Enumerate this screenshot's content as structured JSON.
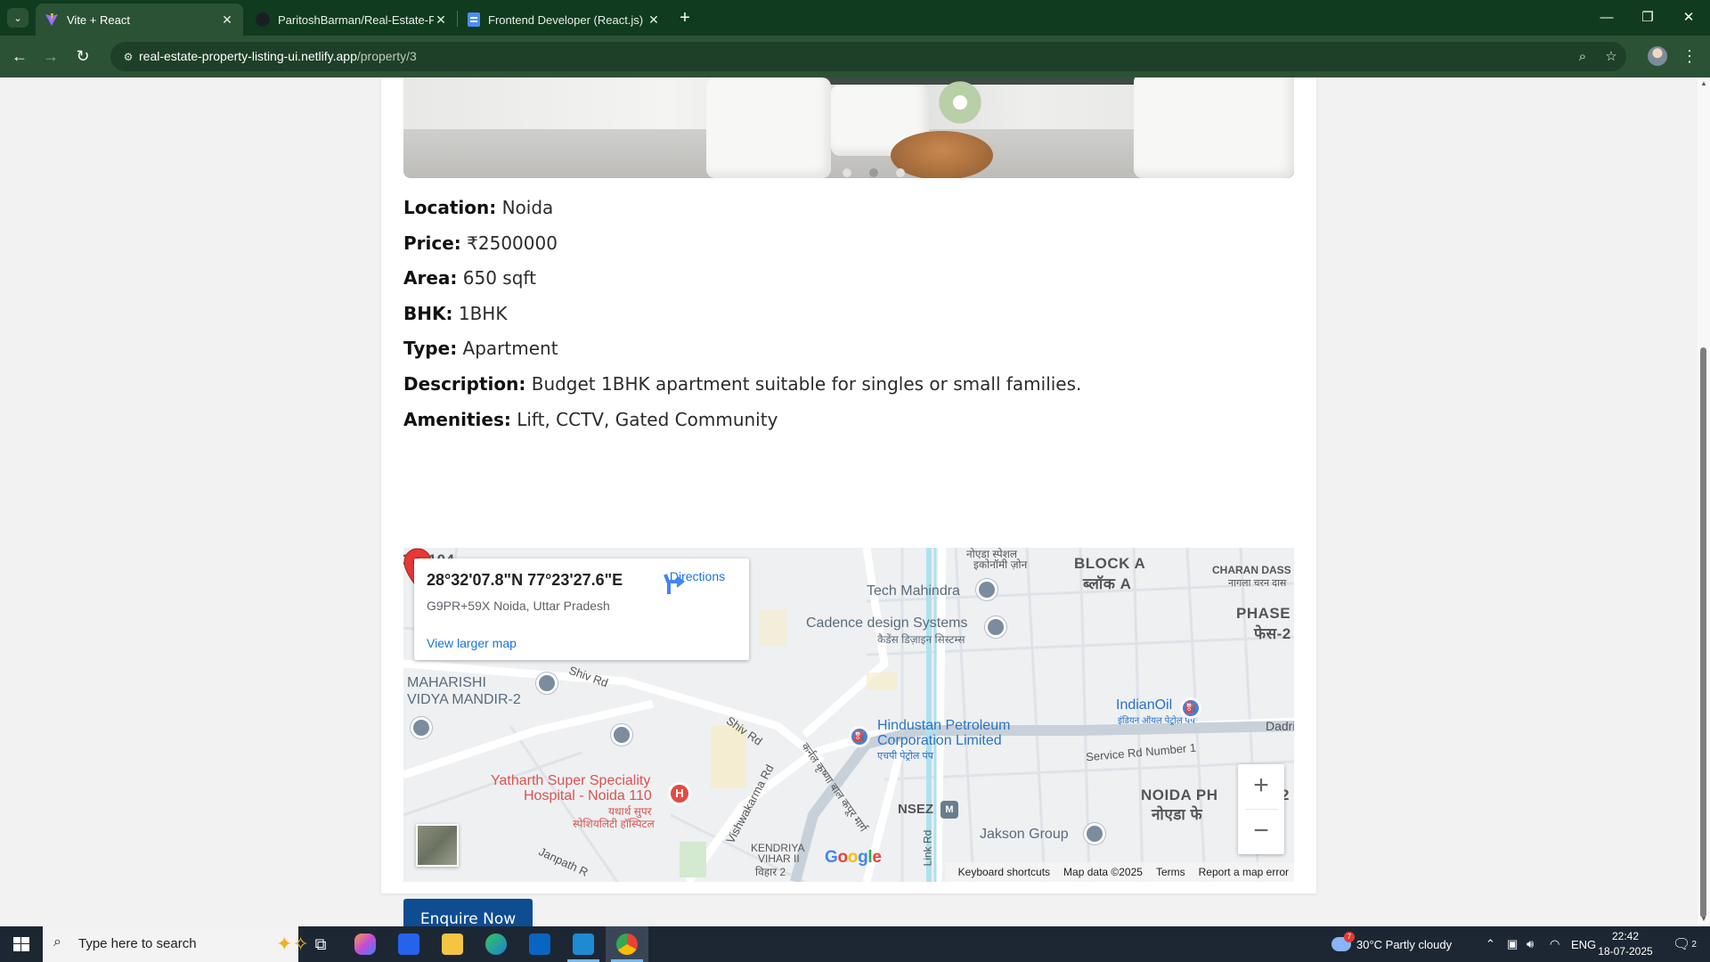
{
  "browser": {
    "tabs": [
      {
        "title": "Vite + React",
        "favicon": "vite-icon",
        "active": true
      },
      {
        "title": "ParitoshBarman/Real-Estate-Pro",
        "favicon": "github-icon",
        "active": false
      },
      {
        "title": "Frontend Developer (React.js) In",
        "favicon": "docs-icon",
        "active": false
      }
    ],
    "url_host": "real-estate-property-listing-ui.netlify.app",
    "url_path": "/property/3"
  },
  "property": {
    "details": [
      {
        "label": "Location:",
        "value": "Noida"
      },
      {
        "label": "Price:",
        "value": "₹2500000"
      },
      {
        "label": "Area:",
        "value": "650 sqft"
      },
      {
        "label": "BHK:",
        "value": "1BHK"
      },
      {
        "label": "Type:",
        "value": "Apartment"
      },
      {
        "label": "Description:",
        "value": "Budget 1BHK apartment suitable for singles or small families."
      },
      {
        "label": "Amenities:",
        "value": "Lift, CCTV, Gated Community"
      }
    ],
    "carousel": {
      "slide_count": 3,
      "active_index": 1
    },
    "enquire_label": "Enquire Now"
  },
  "map": {
    "coordinates": "28°32'07.8\"N 77°23'27.6\"E",
    "plus_code": "G9PR+59X Noida, Uttar Pradesh",
    "directions_label": "Directions",
    "larger_map_label": "View larger map",
    "google_letters": [
      "G",
      "o",
      "o",
      "g",
      "l",
      "e"
    ],
    "google_colors": [
      "#4285F4",
      "#EA4335",
      "#FBBC05",
      "#4285F4",
      "#34A853",
      "#EA4335"
    ],
    "attribution": {
      "shortcuts": "Keyboard shortcuts",
      "data": "Map data ©2025",
      "terms": "Terms",
      "report": "Report a map error"
    },
    "labels": {
      "block_a": "BLOCK A",
      "block_a_hi": "ब्लॉक A",
      "tech_mahindra": "Tech Mahindra",
      "cadence": "Cadence design Systems",
      "cadence_hi": "कैडेंस डिज़ाइन सिस्टम्स",
      "charan": "CHARAN DASS",
      "charan_hi": "नागला चरन दास",
      "phase": "PHASE",
      "phase_hi": "फेस-2",
      "maharishi": "MAHARISHI",
      "vidya": "VIDYA MANDIR-2",
      "shiv_rd_1": "Shiv Rd",
      "shiv_rd_2": "Shiv Rd",
      "hpcl_1": "Hindustan Petroleum",
      "hpcl_2": "Corporation Limited",
      "hpcl_hi": "एचपी पेट्रोल पंप",
      "indianoil": "IndianOil",
      "indianoil_hi": "इंडियन ऑयल पेट्रोल पंप",
      "dadri": "Dadri",
      "service_rd": "Service Rd Number 1",
      "yatharth_1": "Yatharth Super Speciality",
      "yatharth_2": "Hospital - Noida 110",
      "yatharth_hi_1": "यथार्थ सुपर",
      "yatharth_hi_2": "स्पेशियलिटी हॉस्पिटल",
      "vishwakarma": "Vishwakarma Rd",
      "karni": "कर्नल कृष्णा बाल कपूर मार्ग",
      "nsez": "NSEZ",
      "jakson": "Jakson Group",
      "kendriya_1": "KENDRIYA",
      "kendriya_2": "VIHAR II",
      "kendriya_hi": "विहार 2",
      "noida_ph": "NOIDA PH",
      "noida_ph_hi": "नोएडा फे",
      "janpath": "Janpath R",
      "link_rd": "Link Rd",
      "noida_special": "नोएडा स्पेशल",
      "economic_zone": "इकोनॉमी ज़ोन",
      "top_left": "OP-104",
      "phase_2": "2"
    }
  },
  "taskbar": {
    "search_placeholder": "Type here to search",
    "weather": "30°C  Partly cloudy",
    "weather_badge": "7",
    "language": "ENG",
    "time": "22:42",
    "date": "18-07-2025",
    "notifications": "2"
  }
}
